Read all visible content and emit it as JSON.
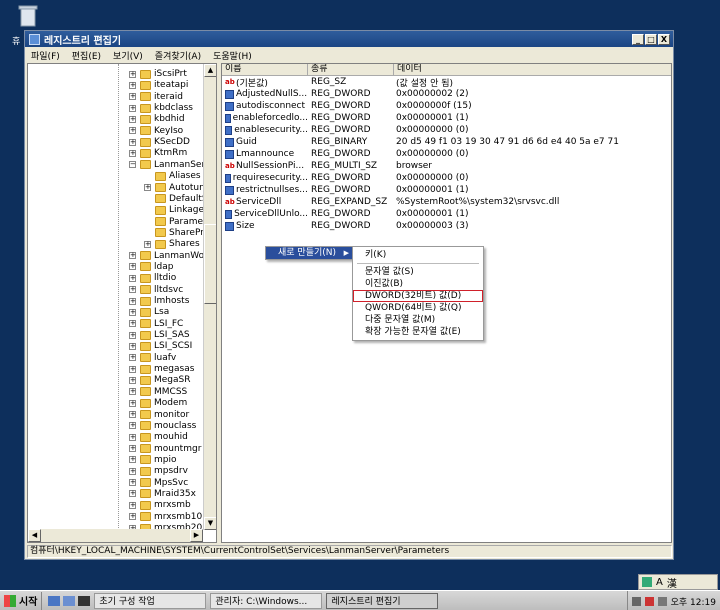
{
  "desktop": {
    "label": "휴"
  },
  "window": {
    "title": "레지스트리 편집기",
    "buttons": [
      "_",
      "□",
      "X"
    ]
  },
  "menubar": [
    "파일(F)",
    "편집(E)",
    "보기(V)",
    "즐겨찾기(A)",
    "도움말(H)"
  ],
  "tree": {
    "items": [
      "iScsiPrt",
      "iteatapi",
      "iteraid",
      "kbdclass",
      "kbdhid",
      "KeyIso",
      "KSecDD",
      "KtmRm",
      "LanmanServer",
      "Aliases",
      "AutotunedParar",
      "DefaultSecurity",
      "Linkage",
      "Parameters",
      "ShareProviders",
      "Shares",
      "LanmanWorkstatio",
      "ldap",
      "lltdio",
      "lltdsvc",
      "lmhosts",
      "Lsa",
      "LSI_FC",
      "LSI_SAS",
      "LSI_SCSI",
      "luafv",
      "megasas",
      "MegaSR",
      "MMCSS",
      "Modem",
      "monitor",
      "mouclass",
      "mouhid",
      "mountmgr",
      "mpio",
      "mpsdrv",
      "MpsSvc",
      "Mraid35x",
      "mrxsmb",
      "mrxsmb10",
      "mrxsmb20"
    ]
  },
  "list": {
    "headers": [
      "이름",
      "종류",
      "데이터"
    ],
    "rows": [
      {
        "name": "(기본값)",
        "type": "REG_SZ",
        "data": "(값 설정 안 됨)",
        "icon": "ab"
      },
      {
        "name": "AdjustedNullS...",
        "type": "REG_DWORD",
        "data": "0x00000002 (2)",
        "icon": "dword"
      },
      {
        "name": "autodisconnect",
        "type": "REG_DWORD",
        "data": "0x0000000f (15)",
        "icon": "dword"
      },
      {
        "name": "enableforcedlo...",
        "type": "REG_DWORD",
        "data": "0x00000001 (1)",
        "icon": "dword"
      },
      {
        "name": "enablesecurity...",
        "type": "REG_DWORD",
        "data": "0x00000000 (0)",
        "icon": "dword"
      },
      {
        "name": "Guid",
        "type": "REG_BINARY",
        "data": "20 d5 49 f1 03 19 30 47 91 d6 6d e4 40 5a e7 71",
        "icon": "dword"
      },
      {
        "name": "Lmannounce",
        "type": "REG_DWORD",
        "data": "0x00000000 (0)",
        "icon": "dword"
      },
      {
        "name": "NullSessionPi...",
        "type": "REG_MULTI_SZ",
        "data": "browser",
        "icon": "ab"
      },
      {
        "name": "requiresecurity...",
        "type": "REG_DWORD",
        "data": "0x00000000 (0)",
        "icon": "dword"
      },
      {
        "name": "restrictnullses...",
        "type": "REG_DWORD",
        "data": "0x00000001 (1)",
        "icon": "dword"
      },
      {
        "name": "ServiceDll",
        "type": "REG_EXPAND_SZ",
        "data": "%SystemRoot%\\system32\\srvsvc.dll",
        "icon": "ab"
      },
      {
        "name": "ServiceDllUnlo...",
        "type": "REG_DWORD",
        "data": "0x00000001 (1)",
        "icon": "dword"
      },
      {
        "name": "Size",
        "type": "REG_DWORD",
        "data": "0x00000003 (3)",
        "icon": "dword"
      }
    ]
  },
  "context_menu": {
    "new_label": "새로 만들기(N)",
    "arrow": "▶"
  },
  "submenu": {
    "key": "키(K)",
    "items": [
      "문자열 값(S)",
      "이진값(B)",
      "DWORD(32비트) 값(D)",
      "QWORD(64비트) 값(Q)",
      "다중 문자열 값(M)",
      "확장 가능한 문자열 값(E)"
    ],
    "highlighted": "DWORD(32비트) 값(D)",
    "highlight_color": "#d0202a"
  },
  "statusbar": "컴퓨터\\HKEY_LOCAL_MACHINE\\SYSTEM\\CurrentControlSet\\Services\\LanmanServer\\Parameters",
  "taskbar": {
    "start": "시작",
    "tasks": [
      "초기 구성 작업",
      "관리자: C:\\Windows...",
      "레지스트리 편집기"
    ],
    "time": "오후 12:19"
  },
  "language_bar": {
    "a": "A",
    "han": "漢"
  }
}
